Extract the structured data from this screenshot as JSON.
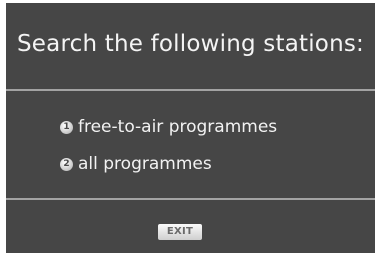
{
  "title": "Search the following stations:",
  "options": [
    {
      "number": "1",
      "label": "free-to-air programmes"
    },
    {
      "number": "2",
      "label": "all programmes"
    }
  ],
  "exit_label": "EXIT",
  "colors": {
    "panel_background": "#464646",
    "text": "#f2f2f2",
    "divider": "#a3a3a3",
    "badge": "#dcdcdc"
  }
}
